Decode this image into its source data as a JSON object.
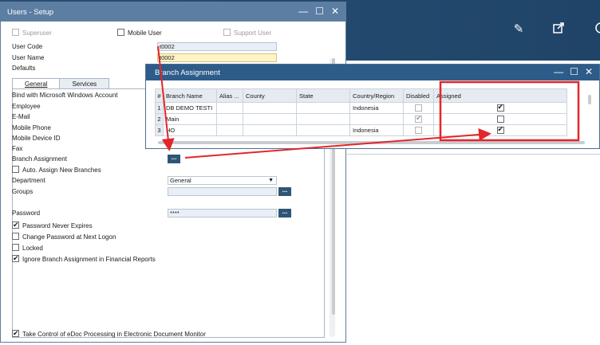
{
  "users_window": {
    "title": "Users - Setup",
    "superuser_label": "Superuser",
    "mobile_user_label": "Mobile User",
    "support_user_label": "Support User",
    "user_code_label": "User Code",
    "user_code_value": "t0002",
    "user_name_label": "User Name",
    "user_name_value": "t0002",
    "defaults_label": "Defaults",
    "tabs": [
      {
        "label": "General",
        "active": true
      },
      {
        "label": "Services",
        "active": false
      }
    ],
    "bind_windows_label": "Bind with Microsoft Windows Account",
    "employee_label": "Employee",
    "email_label": "E-Mail",
    "mobile_phone_label": "Mobile Phone",
    "mobile_device_label": "Mobile Device ID",
    "fax_label": "Fax",
    "branch_assignment_label": "Branch Assignment",
    "auto_assign_label": "Auto. Assign New Branches",
    "department_label": "Department",
    "department_value": "General",
    "groups_label": "Groups",
    "password_label": "Password",
    "password_value": "****",
    "password_never_expires_label": "Password Never Expires",
    "change_password_label": "Change Password at Next Logon",
    "locked_label": "Locked",
    "ignore_branch_label": "Ignore Branch Assignment in Financial Reports",
    "edoc_label": "Take Control of eDoc Processing in Electronic Document Monitor",
    "browse_button_label": "..."
  },
  "branch_window": {
    "title": "Branch Assignment",
    "columns": [
      "#",
      "Branch Name",
      "Alias ...",
      "County",
      "State",
      "Country/Region",
      "Disabled",
      "Assigned"
    ],
    "rows": [
      {
        "num": "1",
        "branch_name": "DB DEMO TESTI",
        "country": "Indonesia",
        "disabled": false,
        "assigned": true
      },
      {
        "num": "2",
        "branch_name": "Main",
        "country": "",
        "disabled": true,
        "assigned": false
      },
      {
        "num": "3",
        "branch_name": "HO",
        "country": "Indonesia",
        "disabled": false,
        "assigned": true
      }
    ]
  },
  "toolbar": {
    "icons": [
      "pencil-icon",
      "export-icon",
      "circle-icon"
    ]
  },
  "colors": {
    "annotation": "#e3262a",
    "title_bar_users": "#5d7ea3",
    "title_bar_branch": "#2e5c8a",
    "top_bar": "#2a4d72"
  }
}
